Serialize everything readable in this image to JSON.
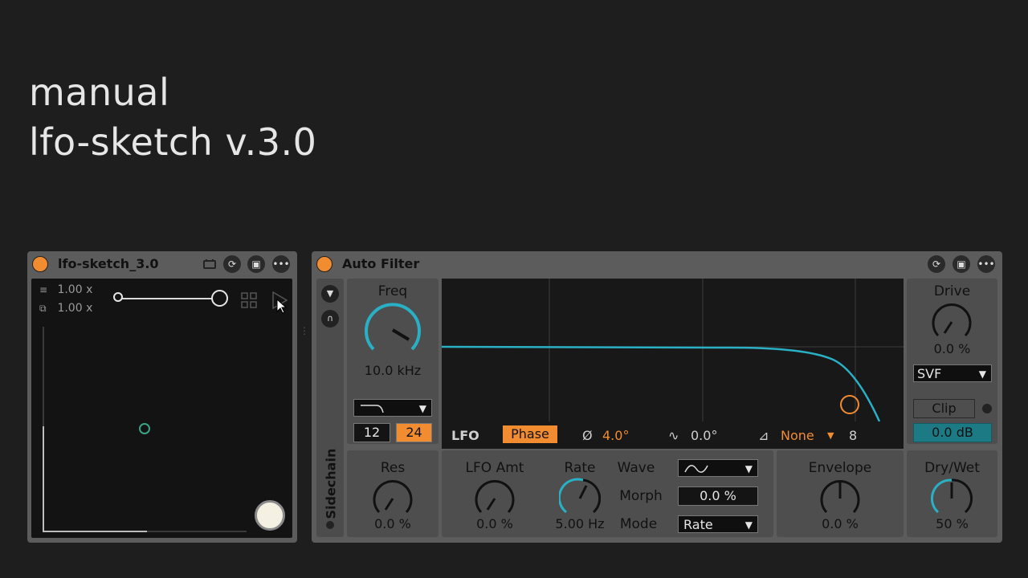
{
  "heading": {
    "line1": "manual",
    "line2": "lfo-sketch v.3.0"
  },
  "colors": {
    "accent": "#f28c30",
    "teal": "#2ab0c5",
    "background": "#1e1e1e"
  },
  "lfo_sketch": {
    "title": "lfo-sketch_3.0",
    "header_icons": [
      "map-icon",
      "sync-icon",
      "save-icon",
      "more-icon"
    ],
    "scale_x": "1.00 x",
    "scale_y": "1.00 x"
  },
  "auto_filter": {
    "title": "Auto Filter",
    "header_icons": [
      "sync-icon",
      "save-icon",
      "more-icon"
    ],
    "sidechain_label": "Sidechain",
    "freq": {
      "label": "Freq",
      "value": "10.0 kHz"
    },
    "filter_type_icon": "lowpass-icon",
    "slope_12": "12",
    "slope_24": "24",
    "res": {
      "label": "Res",
      "value": "0.0 %"
    },
    "lfo_bar": {
      "label": "LFO",
      "phase_button": "Phase",
      "phase_symbol": "Ø",
      "phase_value": "4.0°",
      "offset_value": "0.0°",
      "sync_value": "None",
      "sync_steps": "8"
    },
    "lfo_amt": {
      "label": "LFO Amt",
      "value": "0.0 %"
    },
    "rate": {
      "label": "Rate",
      "value": "5.00 Hz"
    },
    "wave_label": "Wave",
    "morph": {
      "label": "Morph",
      "value": "0.0 %"
    },
    "mode": {
      "label": "Mode",
      "value": "Rate"
    },
    "envelope": {
      "label": "Envelope",
      "value": "0.0 %"
    },
    "drive": {
      "label": "Drive",
      "value": "0.0 %"
    },
    "circuit": "SVF",
    "clip_label": "Clip",
    "clip_value": "0.0 dB",
    "dry_wet": {
      "label": "Dry/Wet",
      "value": "50 %"
    }
  }
}
